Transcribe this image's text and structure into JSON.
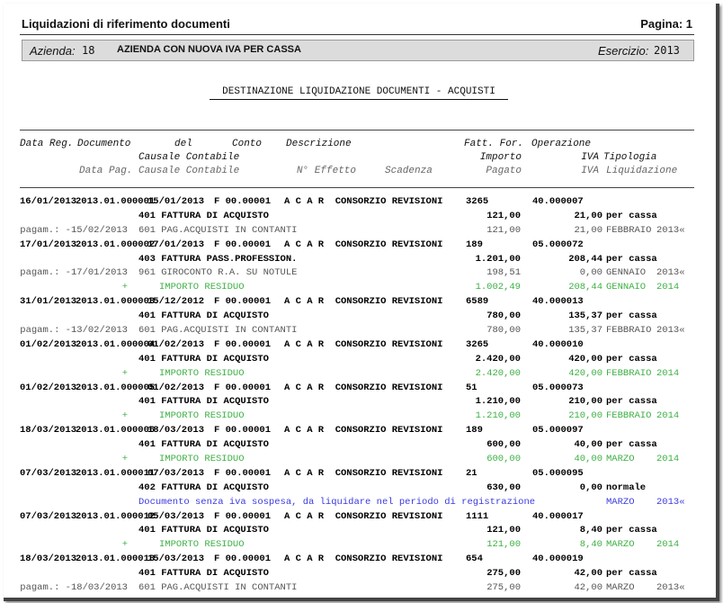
{
  "header": {
    "title": "Liquidazioni di riferimento documenti",
    "page": "Pagina: 1"
  },
  "band": {
    "azienda_label": "Azienda:",
    "azienda_code": "18",
    "azienda_name": "AZIENDA CON NUOVA IVA PER CASSA",
    "esercizio_label": "Esercizio:",
    "esercizio_value": "2013"
  },
  "report_title": "DESTINAZIONE LIQUIDAZIONE DOCUMENTI - ACQUISTI",
  "columns": {
    "data_reg": "Data Reg.",
    "documento": "Documento",
    "del": "del",
    "conto": "Conto",
    "descrizione": "Descrizione",
    "fatt_for": "Fatt. For.",
    "operazione": "Operazione",
    "causale_contabile": "Causale Contabile",
    "importo": "Importo",
    "iva": "IVA",
    "tipologia": "Tipologia",
    "data_pag": "Data Pag.",
    "causale_contabile2": "Causale Contabile",
    "n_effetto": "N° Effetto",
    "scadenza": "Scadenza",
    "pagato": "Pagato",
    "iva2": "IVA",
    "liquidazione": "Liquidazione"
  },
  "rows": [
    {
      "k": "m",
      "data": "16/01/2013",
      "doc": "2013.01.000001",
      "del": "15/01/2013",
      "conto": "F 00.00001",
      "desc": "A C A R  CONSORZIO REVISIONI",
      "fatt": "3265",
      "op": "40.000007"
    },
    {
      "k": "s",
      "caus": "401 FATTURA DI ACQUISTO",
      "imp": "121,00",
      "iva": "21,00",
      "tip": "per cassa"
    },
    {
      "k": "p",
      "pre": "pagam.: -15/02/2013",
      "caus": "601 PAG.ACQUISTI IN CONTANTI",
      "imp": "121,00",
      "iva": "21,00",
      "tip": "FEBBRAIO",
      "yr": "2013«"
    },
    {
      "k": "m",
      "data": "17/01/2013",
      "doc": "2013.01.000002",
      "del": "17/01/2013",
      "conto": "F 00.00001",
      "desc": "A C A R  CONSORZIO REVISIONI",
      "fatt": "189",
      "op": "05.000072"
    },
    {
      "k": "s",
      "caus": "403 FATTURA PASS.PROFESSION.",
      "imp": "1.201,00",
      "iva": "208,44",
      "tip": "per cassa"
    },
    {
      "k": "p",
      "pre": "pagam.: -17/01/2013",
      "caus": "961 GIROCONTO R.A. SU NOTULE",
      "imp": "198,51",
      "iva": "0,00",
      "tip": "GENNAIO",
      "yr": "2013«"
    },
    {
      "k": "r",
      "pre": "+",
      "caus": "IMPORTO RESIDUO",
      "imp": "1.002,49",
      "iva": "208,44",
      "tip": "GENNAIO",
      "yr": "2014"
    },
    {
      "k": "m",
      "data": "31/01/2013",
      "doc": "2013.01.000003",
      "del": "15/12/2012",
      "conto": "F 00.00001",
      "desc": "A C A R  CONSORZIO REVISIONI",
      "fatt": "6589",
      "op": "40.000013"
    },
    {
      "k": "s",
      "caus": "401 FATTURA DI ACQUISTO",
      "imp": "780,00",
      "iva": "135,37",
      "tip": "per cassa"
    },
    {
      "k": "p",
      "pre": "pagam.: -13/02/2013",
      "caus": "601 PAG.ACQUISTI IN CONTANTI",
      "imp": "780,00",
      "iva": "135,37",
      "tip": "FEBBRAIO",
      "yr": "2013«"
    },
    {
      "k": "m",
      "data": "01/02/2013",
      "doc": "2013.01.000004",
      "del": "01/02/2013",
      "conto": "F 00.00001",
      "desc": "A C A R  CONSORZIO REVISIONI",
      "fatt": "3265",
      "op": "40.000010"
    },
    {
      "k": "s",
      "caus": "401 FATTURA DI ACQUISTO",
      "imp": "2.420,00",
      "iva": "420,00",
      "tip": "per cassa"
    },
    {
      "k": "r",
      "pre": "+",
      "caus": "IMPORTO RESIDUO",
      "imp": "2.420,00",
      "iva": "420,00",
      "tip": "FEBBRAIO",
      "yr": "2014"
    },
    {
      "k": "m",
      "data": "01/02/2013",
      "doc": "2013.01.000005",
      "del": "01/02/2013",
      "conto": "F 00.00001",
      "desc": "A C A R  CONSORZIO REVISIONI",
      "fatt": "51",
      "op": "05.000073"
    },
    {
      "k": "s",
      "caus": "401 FATTURA DI ACQUISTO",
      "imp": "1.210,00",
      "iva": "210,00",
      "tip": "per cassa"
    },
    {
      "k": "r",
      "pre": "+",
      "caus": "IMPORTO RESIDUO",
      "imp": "1.210,00",
      "iva": "210,00",
      "tip": "FEBBRAIO",
      "yr": "2014"
    },
    {
      "k": "m",
      "data": "18/03/2013",
      "doc": "2013.01.000006",
      "del": "18/03/2013",
      "conto": "F 00.00001",
      "desc": "A C A R  CONSORZIO REVISIONI",
      "fatt": "189",
      "op": "05.000097"
    },
    {
      "k": "s",
      "caus": "401 FATTURA DI ACQUISTO",
      "imp": "600,00",
      "iva": "40,00",
      "tip": "per cassa"
    },
    {
      "k": "r",
      "pre": "+",
      "caus": "IMPORTO RESIDUO",
      "imp": "600,00",
      "iva": "40,00",
      "tip": "MARZO",
      "yr": "2014"
    },
    {
      "k": "m",
      "data": "07/03/2013",
      "doc": "2013.01.000011",
      "del": "07/03/2013",
      "conto": "F 00.00001",
      "desc": "A C A R  CONSORZIO REVISIONI",
      "fatt": "21",
      "op": "05.000095"
    },
    {
      "k": "s",
      "caus": "402 FATTURA DI ACQUISTO",
      "imp": "630,00",
      "iva": "0,00",
      "tip": "normale"
    },
    {
      "k": "n",
      "note": "Documento senza iva sospesa, da liquidare nel periodo di registrazione",
      "tip": "MARZO",
      "yr": "2013«"
    },
    {
      "k": "m",
      "data": "07/03/2013",
      "doc": "2013.01.000012",
      "del": "05/03/2013",
      "conto": "F 00.00001",
      "desc": "A C A R  CONSORZIO REVISIONI",
      "fatt": "1111",
      "op": "40.000017"
    },
    {
      "k": "s",
      "caus": "401 FATTURA DI ACQUISTO",
      "imp": "121,00",
      "iva": "8,40",
      "tip": "per cassa"
    },
    {
      "k": "r",
      "pre": "+",
      "caus": "IMPORTO RESIDUO",
      "imp": "121,00",
      "iva": "8,40",
      "tip": "MARZO",
      "yr": "2014"
    },
    {
      "k": "m",
      "data": "18/03/2013",
      "doc": "2013.01.000013",
      "del": "15/03/2013",
      "conto": "F 00.00001",
      "desc": "A C A R  CONSORZIO REVISIONI",
      "fatt": "654",
      "op": "40.000019"
    },
    {
      "k": "s",
      "caus": "401 FATTURA DI ACQUISTO",
      "imp": "275,00",
      "iva": "42,00",
      "tip": "per cassa"
    },
    {
      "k": "p",
      "pre": "pagam.: -18/03/2013",
      "caus": "601 PAG.ACQUISTI IN CONTANTI",
      "imp": "275,00",
      "iva": "42,00",
      "tip": "MARZO",
      "yr": "2013«"
    }
  ]
}
